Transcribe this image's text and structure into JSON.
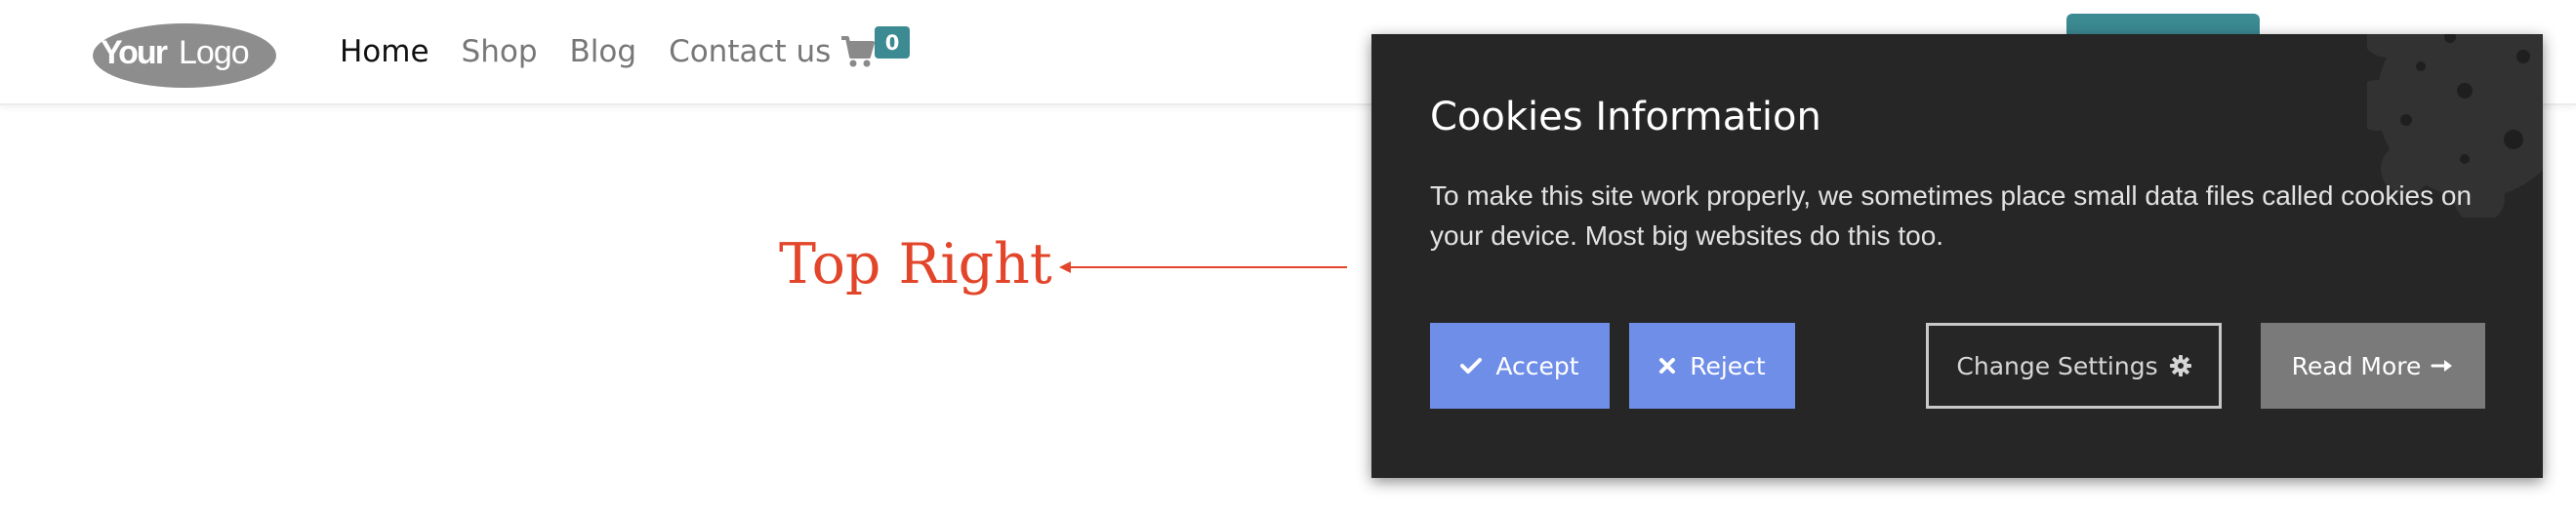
{
  "header": {
    "logo_text": "YourLogo",
    "nav": [
      {
        "label": "Home",
        "active": true
      },
      {
        "label": "Shop",
        "active": false
      },
      {
        "label": "Blog",
        "active": false
      },
      {
        "label": "Contact us",
        "active": false
      }
    ],
    "cart_icon": "shopping-cart-icon",
    "cart_count": "0"
  },
  "annotation": {
    "label": "Top Right",
    "arrow_icon": "arrow-left-icon"
  },
  "cookie_modal": {
    "title": "Cookies Information",
    "text": "To make this site work properly, we sometimes place small data files called cookies on your device. Most big websites do this too.",
    "buttons": {
      "accept": "Accept",
      "reject": "Reject",
      "settings": "Change Settings",
      "read_more": "Read More"
    },
    "icons": {
      "accept": "checkmark-icon",
      "reject": "x-icon",
      "settings": "gear-icon",
      "read_more": "arrow-right-icon",
      "decoration": "cookie-icon"
    }
  },
  "colors": {
    "accent_teal": "#3c8a92",
    "button_blue": "#6f8ee8",
    "annotation_red": "#e2452a",
    "modal_bg": "#262626",
    "read_more_gray": "#7a7a7a"
  }
}
